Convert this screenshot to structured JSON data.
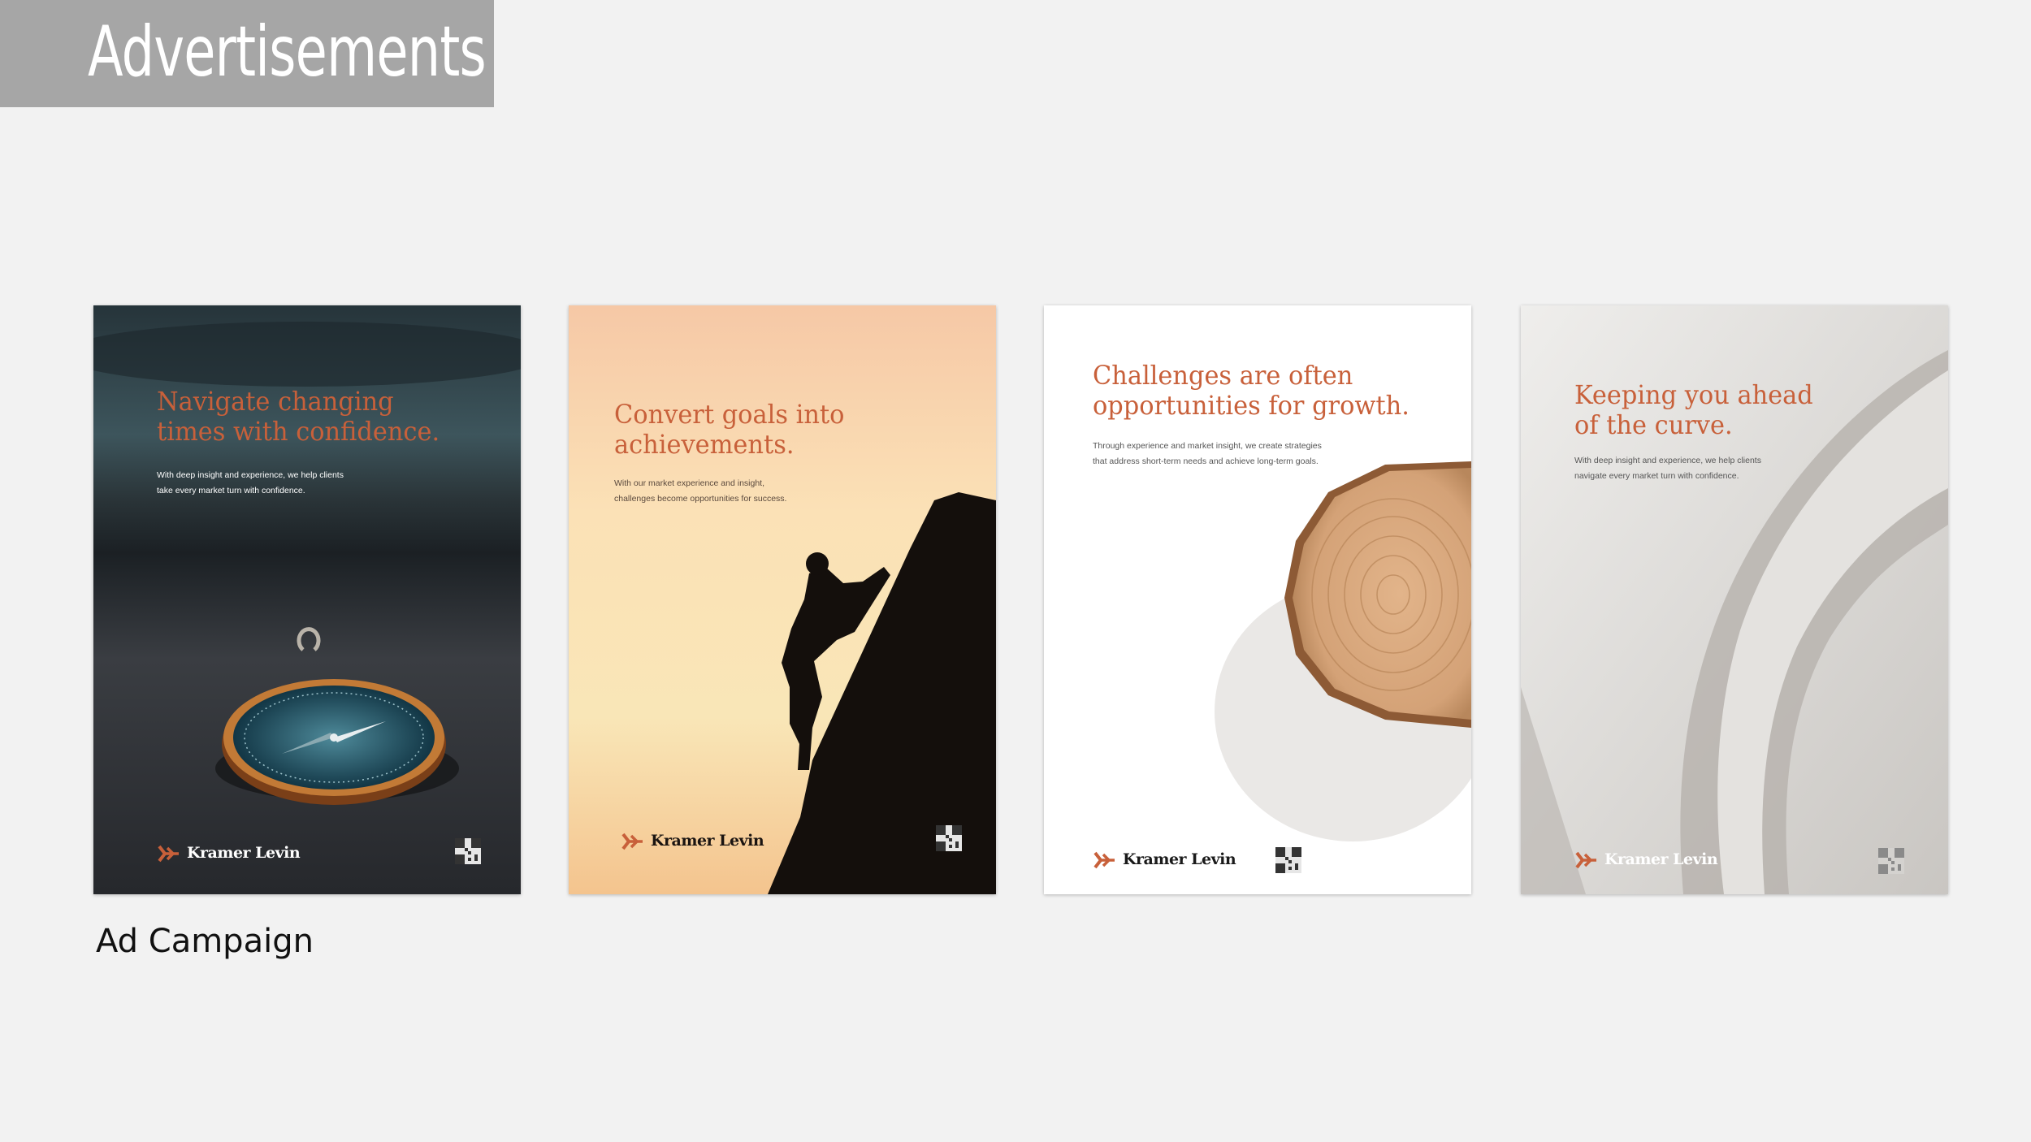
{
  "page": {
    "title": "Advertisements",
    "caption": "Ad Campaign"
  },
  "colors": {
    "accent": "#c8603a",
    "title_bar": "#a6a6a6",
    "background": "#f2f2f2"
  },
  "posters": [
    {
      "name": "compass",
      "headline": "Navigate changing\ntimes with confidence.",
      "body": "With deep insight and experience, we help clients\ntake every market turn with confidence.",
      "brand": "Kramer Levin"
    },
    {
      "name": "climber",
      "headline": "Convert goals into\nachievements.",
      "body": "With our market experience and insight,\nchallenges become opportunities for success.",
      "brand": "Kramer Levin"
    },
    {
      "name": "tree-ring",
      "headline": "Challenges are often\nopportunities for growth.",
      "body": "Through experience and market insight, we create strategies\nthat address short-term needs and achieve long-term goals.",
      "brand": "Kramer Levin"
    },
    {
      "name": "paper-curve",
      "headline": "Keeping you ahead\nof the curve.",
      "body": "With deep insight and experience, we help clients\nnavigate every market turn with confidence.",
      "brand": "Kramer Levin"
    }
  ]
}
